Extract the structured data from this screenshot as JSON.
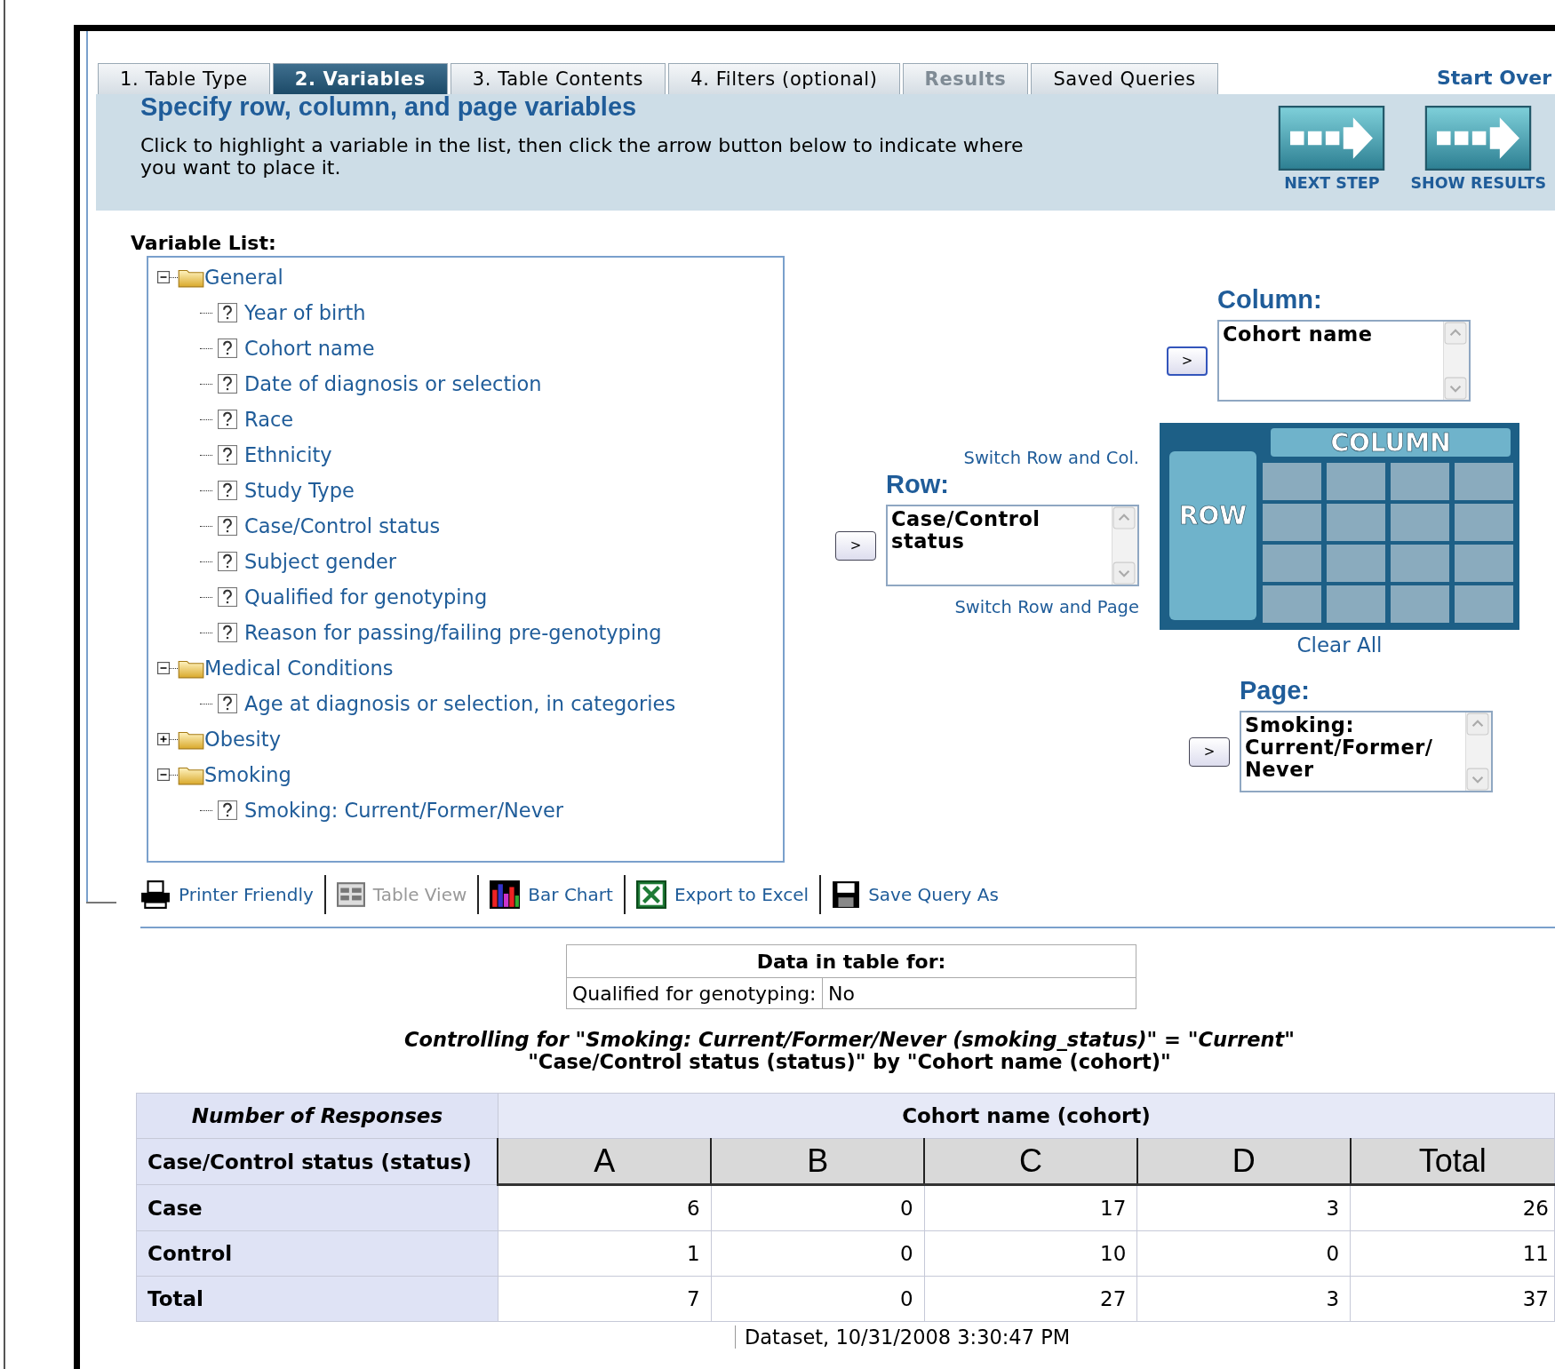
{
  "tabs": [
    {
      "label": "1. Table Type",
      "selected": false,
      "disabled": false
    },
    {
      "label": "2. Variables",
      "selected": true,
      "disabled": false
    },
    {
      "label": "3. Table Contents",
      "selected": false,
      "disabled": false
    },
    {
      "label": "4. Filters (optional)",
      "selected": false,
      "disabled": false
    },
    {
      "label": "Results",
      "selected": false,
      "disabled": true
    },
    {
      "label": "Saved Queries",
      "selected": false,
      "disabled": false
    }
  ],
  "start_over": "Start Over",
  "header": {
    "title": "Specify row, column, and page variables",
    "instructions": "Click to highlight a variable in the list, then click the arrow button below to indicate where you want to place it."
  },
  "step_buttons": [
    "NEXT STEP",
    "SHOW RESULTS"
  ],
  "variable_list": {
    "label": "Variable List:",
    "tree": [
      {
        "label": "General",
        "expanded": true,
        "children": [
          {
            "label": "Year of birth"
          },
          {
            "label": "Cohort name"
          },
          {
            "label": "Date of diagnosis or selection"
          },
          {
            "label": "Race"
          },
          {
            "label": "Ethnicity"
          },
          {
            "label": "Study Type"
          },
          {
            "label": "Case/Control status"
          },
          {
            "label": "Subject gender"
          },
          {
            "label": "Qualified for genotyping"
          },
          {
            "label": "Reason for passing/failing pre-genotyping"
          }
        ]
      },
      {
        "label": "Medical Conditions",
        "expanded": true,
        "children": [
          {
            "label": "Age at diagnosis or selection, in categories"
          }
        ]
      },
      {
        "label": "Obesity",
        "expanded": false
      },
      {
        "label": "Smoking",
        "expanded": true,
        "children": [
          {
            "label": "Smoking: Current/Former/Never"
          }
        ]
      }
    ]
  },
  "column": {
    "label": "Column:",
    "button": ">",
    "value": "Cohort name"
  },
  "switch_row_col": "Switch Row and Col.",
  "row": {
    "label": "Row:",
    "button": ">",
    "value": "Case/Control status"
  },
  "switch_row_page": "Switch Row and Page",
  "layout_diagram": {
    "column_label": "COLUMN",
    "row_label": "ROW"
  },
  "clear_all": "Clear All",
  "page": {
    "label": "Page:",
    "button": ">",
    "value": "Smoking: Current/Former/ Never"
  },
  "toolbar": [
    {
      "kind": "printer",
      "label": "Printer Friendly",
      "disabled": false
    },
    {
      "kind": "table",
      "label": "Table View",
      "disabled": true
    },
    {
      "kind": "chart",
      "label": "Bar Chart",
      "disabled": false
    },
    {
      "kind": "excel",
      "label": "Export to Excel",
      "disabled": false
    },
    {
      "kind": "save",
      "label": "Save Query As",
      "disabled": false
    }
  ],
  "filter_table": {
    "title": "Data in table for:",
    "rows": [
      {
        "label": "Qualified for genotyping:",
        "value": "No"
      }
    ]
  },
  "caption": [
    "Controlling for \"Smoking: Current/Former/Never (smoking_status)\" = \"Current\"",
    "\"Case/Control status (status)\" by \"Cohort name (cohort)\""
  ],
  "results": {
    "corner": "Number of Responses",
    "column_group": "Cohort name (cohort)",
    "row_header": "Case/Control status (status)",
    "columns": [
      "A",
      "B",
      "C",
      "D",
      "Total"
    ],
    "rows": [
      {
        "label": "Case",
        "values": [
          "6",
          "0",
          "17",
          "3",
          "26"
        ]
      },
      {
        "label": "Control",
        "values": [
          "1",
          "0",
          "10",
          "0",
          "11"
        ]
      },
      {
        "label": "Total",
        "values": [
          "7",
          "0",
          "27",
          "3",
          "37"
        ]
      }
    ]
  },
  "footer": "Dataset, 10/31/2008 3:30:47 PM"
}
